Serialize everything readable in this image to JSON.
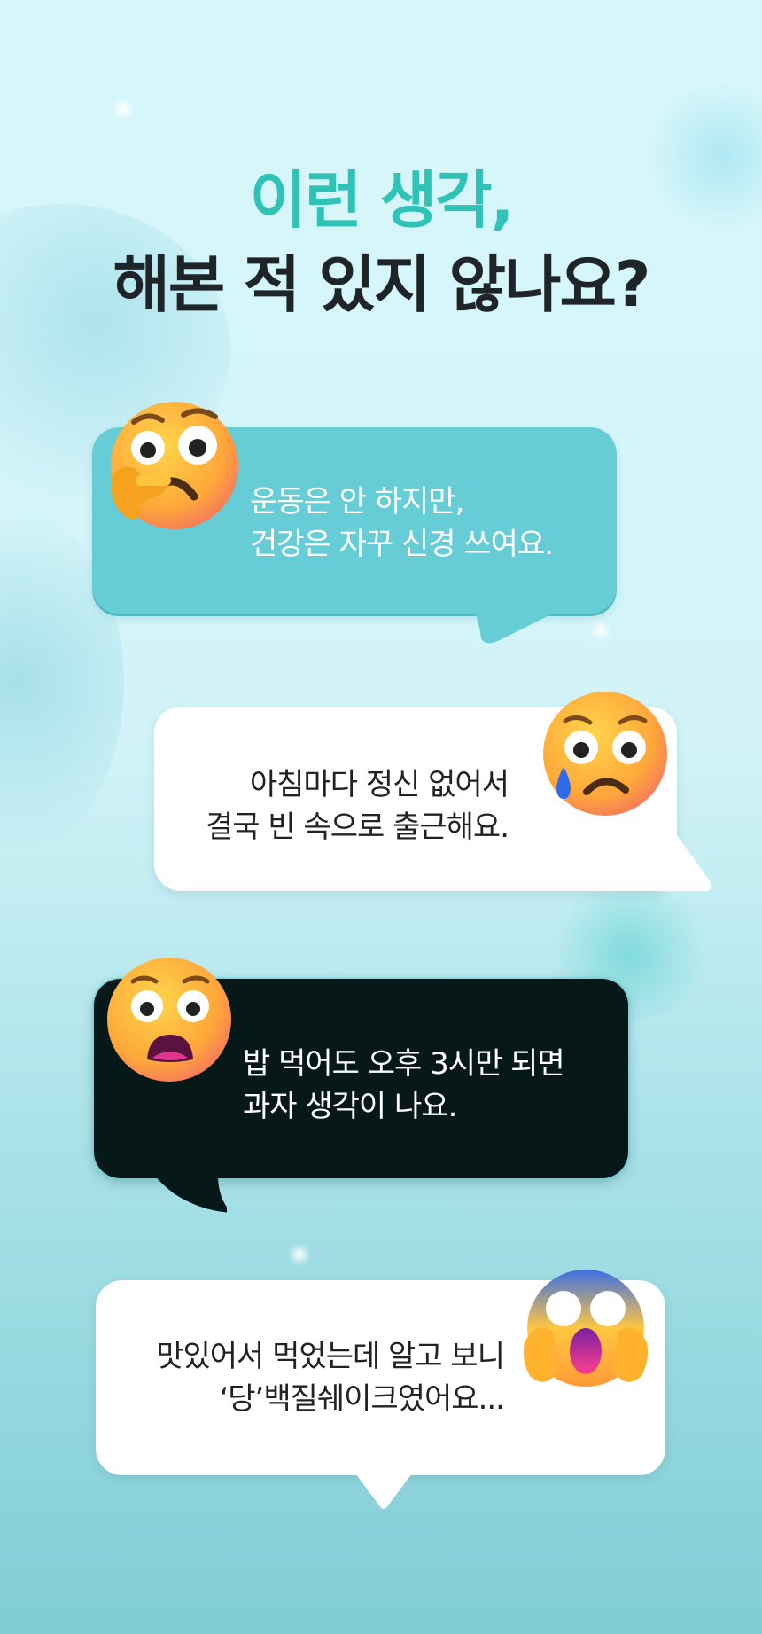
{
  "title": {
    "line1": "이런 생각,",
    "line2": "해본 적 있지 않나요?",
    "accent_color": "#2ec3b6"
  },
  "bubbles": [
    {
      "lines": [
        "운동은 안 하지만,",
        "건강은 자꾸 신경 쓰여요."
      ],
      "emoji": "thinking-face",
      "color": "#66cdd6"
    },
    {
      "lines": [
        "아침마다 정신 없어서",
        "결국 빈 속으로 출근해요."
      ],
      "emoji": "sad-tear-face",
      "color": "#ffffff"
    },
    {
      "lines": [
        "밥 먹어도 오후 3시만 되면",
        "과자 생각이 나요."
      ],
      "emoji": "anguished-face",
      "color": "#071818"
    },
    {
      "lines": [
        "맛있어서 먹었는데 알고 보니",
        "‘당’백질쉐이크였어요..."
      ],
      "emoji": "screaming-face",
      "color": "#ffffff"
    }
  ]
}
